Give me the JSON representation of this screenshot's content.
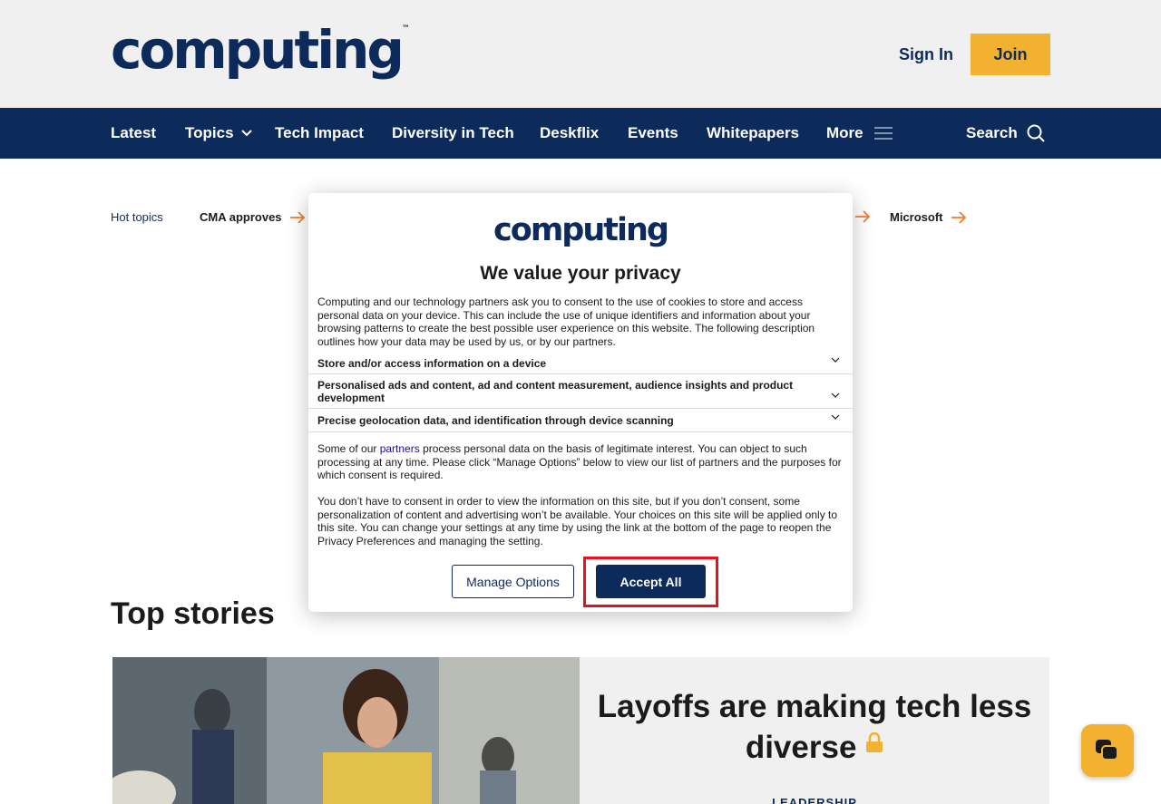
{
  "header": {
    "logo": "computing",
    "logo_tm": "™",
    "sign_in": "Sign In",
    "join": "Join"
  },
  "nav": {
    "items": [
      {
        "label": "Latest"
      },
      {
        "label": "Topics"
      },
      {
        "label": "Tech Impact"
      },
      {
        "label": "Diversity in Tech"
      },
      {
        "label": "Deskflix"
      },
      {
        "label": "Events"
      },
      {
        "label": "Whitepapers"
      },
      {
        "label": "More"
      }
    ],
    "search": "Search"
  },
  "hot_topics": {
    "label": "Hot topics",
    "items": [
      "CMA approves",
      "Microsoft"
    ]
  },
  "top_stories": {
    "heading": "Top stories",
    "story": {
      "title": "Layoffs are making tech less diverse",
      "category": "LEADERSHIP"
    }
  },
  "consent": {
    "logo": "computing",
    "title": "We value your privacy",
    "intro": "Computing and our technology partners ask you to consent to the use of cookies to store and access personal data on your device. This can include the use of unique identifiers and information about your browsing patterns to create the best possible user experience on this website. The following description outlines how your data may be used by us, or by our partners.",
    "purposes": [
      "Store and/or access information on a device",
      "Personalised ads and content, ad and content measurement, audience insights and product development",
      "Precise geolocation data, and identification through device scanning"
    ],
    "legit_prefix": "Some of our ",
    "legit_link": "partners",
    "legit_suffix": " process personal data on the basis of legitimate interest. You can object to such processing at any time. Please click “Manage Options” below to view our list of partners and the purposes for which consent is required.",
    "no_consent": "You don’t have to consent in order to view the information on this site, but if you don’t consent, some personalization of content and advertising won’t be available. Your choices on this site will be applied only to this site. You can change your settings at any time by using the link at the bottom of the page to reopen the Privacy Preferences and managing the setting.",
    "manage_options": "Manage Options",
    "accept_all": "Accept All"
  },
  "colors": {
    "navy": "#0d2b5a",
    "accent": "#f2b12e",
    "hot_arrow": "#f07c32",
    "highlight": "#e8101a"
  }
}
